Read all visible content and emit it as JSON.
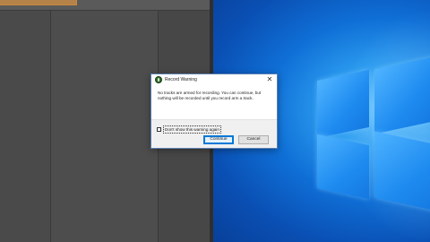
{
  "dialog": {
    "title": "Record Warning",
    "close_label": "✕",
    "message": "No tracks are armed for recording. You can continue, but nothing will be recorded until you record arm a track.",
    "checkbox_label": "Don't show this warning again",
    "checkbox_checked": false,
    "continue_label": "Continue",
    "cancel_label": "Cancel"
  },
  "colors": {
    "daw_background": "#4c4c4c",
    "clip_accent": "#b5824a",
    "desktop_blue": "#0f6fd6",
    "focus_border": "#0078d7"
  },
  "icons": {
    "app_icon": "shield-app-icon",
    "close_icon": "close-icon"
  }
}
